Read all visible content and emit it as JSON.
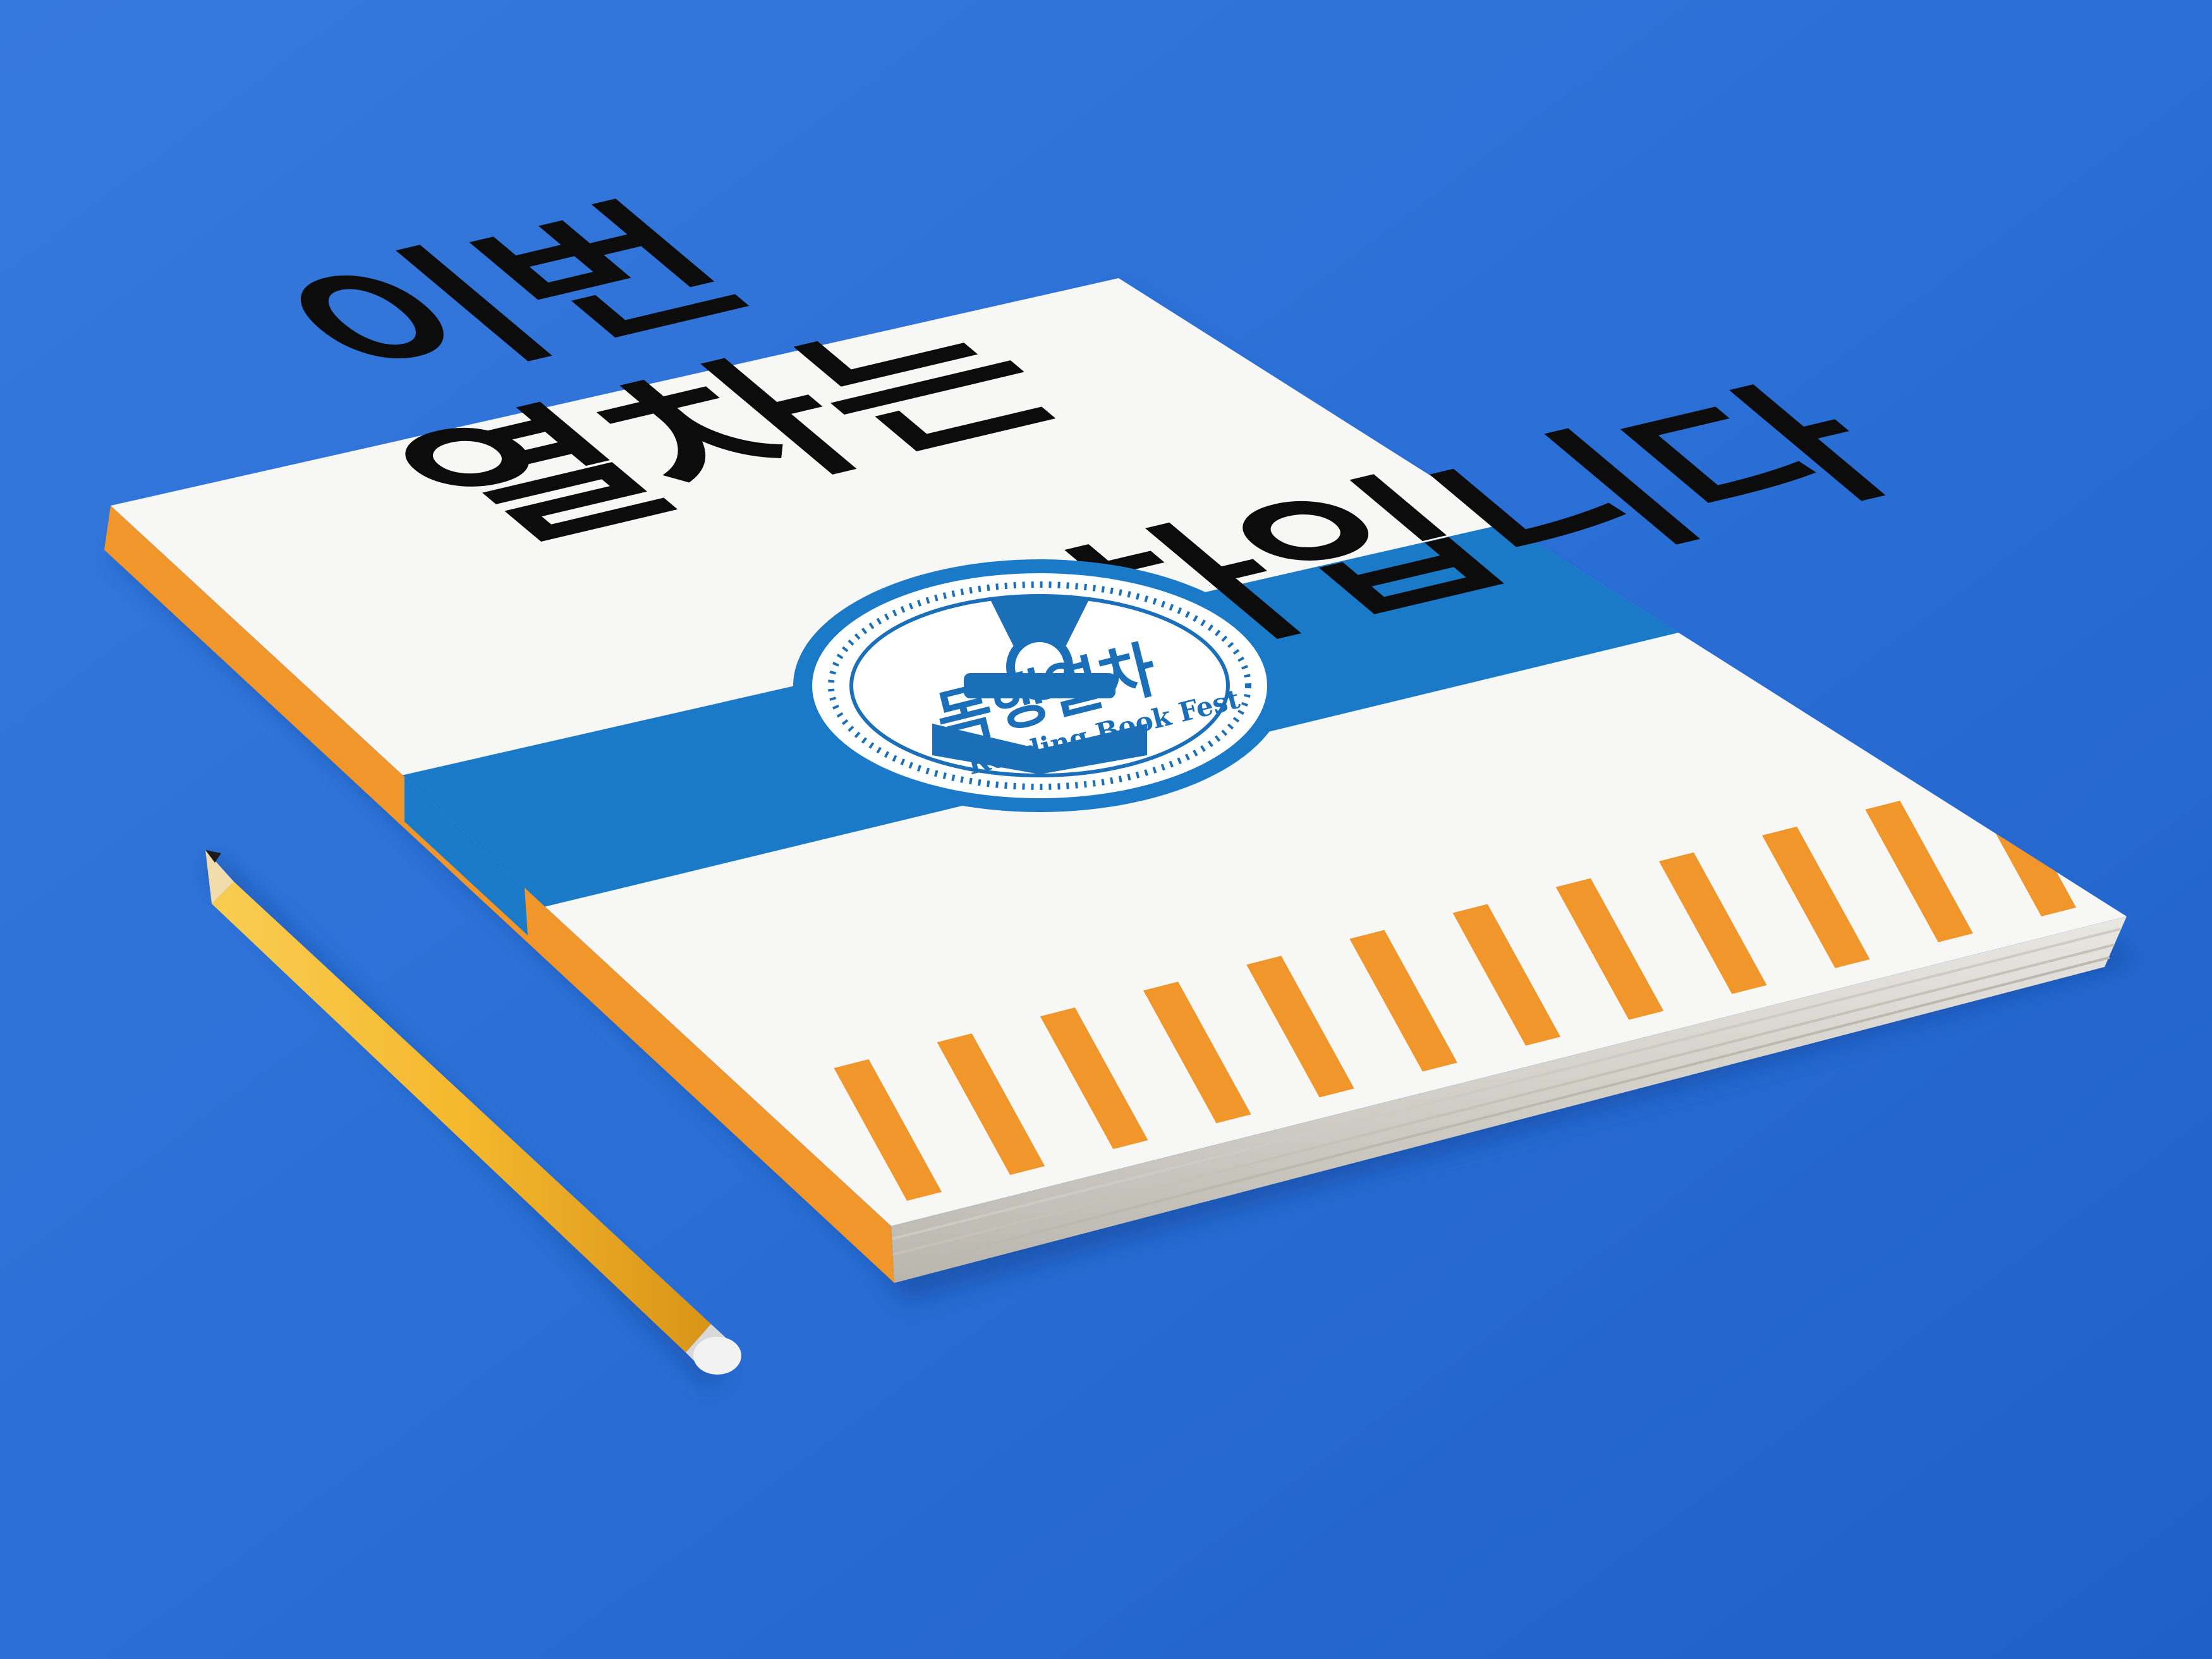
{
  "scene": {
    "description_objects": [
      "book-mockup",
      "pencil"
    ],
    "background_color": "#2a6fd6"
  },
  "book": {
    "cover_color": "#f7f7f5",
    "band_color": "#1a7ac8",
    "stripe_color": "#f0962a",
    "headline": {
      "line1": "이번",
      "line2": "열차는",
      "line3": "열차입니다"
    },
    "stripe_count": 12
  },
  "badge": {
    "title": "독행열차",
    "subtitle": "Reading Book Fest",
    "color": "#1b6fb8"
  },
  "pencil": {
    "body_color": "#f5b82e",
    "eraser_color": "#f2f2f2"
  }
}
